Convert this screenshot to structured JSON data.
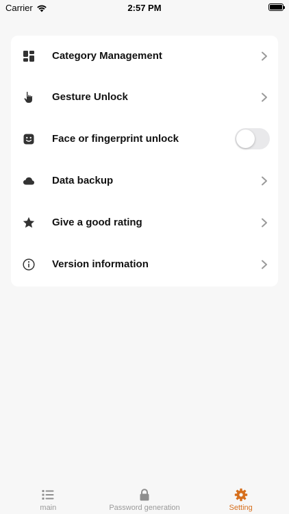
{
  "status_bar": {
    "carrier": "Carrier",
    "time": "2:57 PM"
  },
  "settings": {
    "items": [
      {
        "label": "Category Management",
        "icon": "category-icon",
        "control": "chevron"
      },
      {
        "label": "Gesture Unlock",
        "icon": "hand-pointer-icon",
        "control": "chevron"
      },
      {
        "label": "Face or fingerprint unlock",
        "icon": "face-id-icon",
        "control": "toggle",
        "toggle_on": false
      },
      {
        "label": "Data backup",
        "icon": "cloud-icon",
        "control": "chevron"
      },
      {
        "label": "Give a good rating",
        "icon": "star-icon",
        "control": "chevron"
      },
      {
        "label": "Version information",
        "icon": "info-icon",
        "control": "chevron"
      }
    ]
  },
  "tab_bar": {
    "tabs": [
      {
        "label": "main",
        "icon": "list-icon",
        "active": false
      },
      {
        "label": "Password generation",
        "icon": "lock-icon",
        "active": false
      },
      {
        "label": "Setting",
        "icon": "gear-icon",
        "active": true
      }
    ],
    "active_color": "#d66f1d",
    "inactive_color": "#9a9a9a"
  }
}
